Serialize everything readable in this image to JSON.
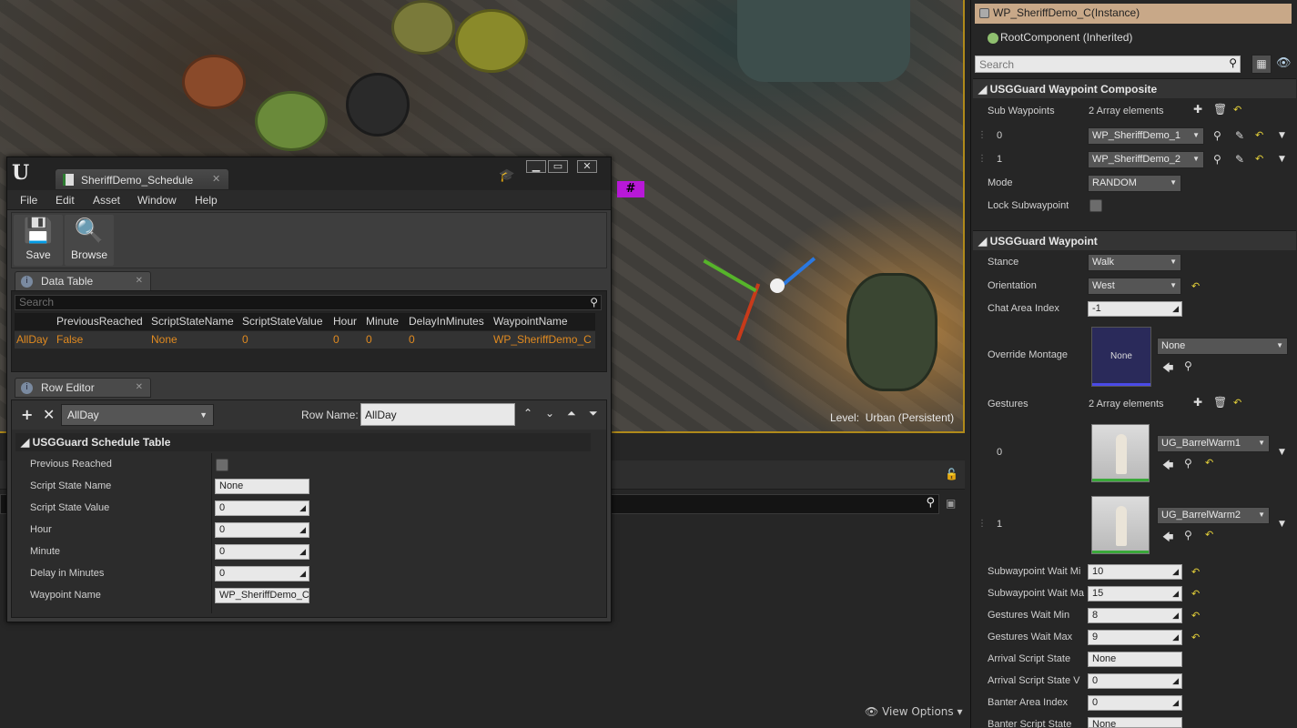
{
  "viewport": {
    "level_label": "Level:",
    "level_value": "Urban (Persistent)",
    "badge": "#",
    "view_options": "View Options"
  },
  "editor": {
    "tab_title": "SheriffDemo_Schedule",
    "menu": [
      "File",
      "Edit",
      "Asset",
      "Window",
      "Help"
    ],
    "toolbar": {
      "save": "Save",
      "browse": "Browse"
    },
    "data_table": {
      "tab": "Data Table",
      "search_placeholder": "Search",
      "columns": [
        "PreviousReached",
        "ScriptStateName",
        "ScriptStateValue",
        "Hour",
        "Minute",
        "DelayInMinutes",
        "WaypointName"
      ],
      "rows": [
        {
          "name": "AllDay",
          "values": [
            "False",
            "None",
            "0",
            "0",
            "0",
            "0",
            "WP_SheriffDemo_C"
          ]
        }
      ]
    },
    "row_editor": {
      "tab": "Row Editor",
      "selected_row": "AllDay",
      "row_name_label": "Row Name:",
      "row_name": "AllDay",
      "section": "USGGuard Schedule Table",
      "props": [
        {
          "label": "Previous Reached",
          "value": ""
        },
        {
          "label": "Script State Name",
          "value": "None"
        },
        {
          "label": "Script State Value",
          "value": "0"
        },
        {
          "label": "Hour",
          "value": "0"
        },
        {
          "label": "Minute",
          "value": "0"
        },
        {
          "label": "Delay in Minutes",
          "value": "0"
        },
        {
          "label": "Waypoint Name",
          "value": "WP_SheriffDemo_C"
        }
      ]
    }
  },
  "details": {
    "instance": "WP_SheriffDemo_C(Instance)",
    "root": "RootComponent (Inherited)",
    "search_placeholder": "Search",
    "composite": {
      "header": "USGGuard Waypoint Composite",
      "sub_label": "Sub Waypoints",
      "sub_count": "2 Array elements",
      "items": [
        {
          "index": "0",
          "value": "WP_SheriffDemo_1"
        },
        {
          "index": "1",
          "value": "WP_SheriffDemo_2"
        }
      ],
      "mode_label": "Mode",
      "mode_value": "RANDOM",
      "lock_label": "Lock Subwaypoint"
    },
    "waypoint": {
      "header": "USGGuard Waypoint",
      "stance_label": "Stance",
      "stance_value": "Walk",
      "orientation_label": "Orientation",
      "orientation_value": "West",
      "chat_label": "Chat Area Index",
      "chat_value": "-1",
      "montage_label": "Override Montage",
      "montage_thumb": "None",
      "montage_value": "None",
      "gestures_label": "Gestures",
      "gestures_count": "2 Array elements",
      "gestures": [
        {
          "index": "0",
          "value": "UG_BarrelWarm1"
        },
        {
          "index": "1",
          "value": "UG_BarrelWarm2"
        }
      ],
      "numeric": [
        {
          "label": "Subwaypoint Wait Mi",
          "value": "10"
        },
        {
          "label": "Subwaypoint Wait Ma",
          "value": "15"
        },
        {
          "label": "Gestures Wait Min",
          "value": "8"
        },
        {
          "label": "Gestures Wait Max",
          "value": "9"
        }
      ],
      "arrival_state_label": "Arrival Script State",
      "arrival_state_value": "None",
      "arrival_value_label": "Arrival Script State V",
      "arrival_value_value": "0",
      "banter_label": "Banter Area Index",
      "banter_value": "0",
      "banter_state_label": "Banter Script State",
      "banter_state_value": "None"
    }
  }
}
